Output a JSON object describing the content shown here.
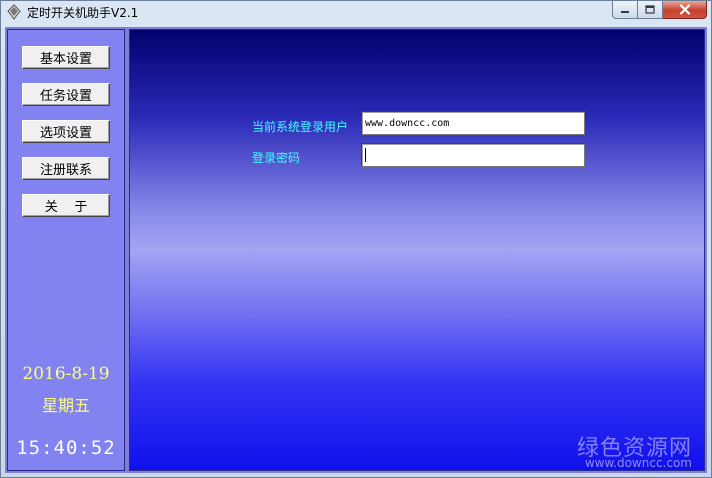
{
  "window": {
    "title": "定时开关机助手V2.1"
  },
  "sidebar": {
    "buttons": [
      {
        "label": "基本设置"
      },
      {
        "label": "任务设置"
      },
      {
        "label": "选项设置"
      },
      {
        "label": "注册联系"
      },
      {
        "label": "关    于"
      }
    ],
    "date": "2016-8-19",
    "weekday": "星期五",
    "time": "15:40:52"
  },
  "login": {
    "user_label": "当前系统登录用户",
    "user_value": "www.downcc.com",
    "password_label": "登录密码",
    "password_value": ""
  },
  "watermark": {
    "site_name": "绿色资源网",
    "url": "www.downcc.com"
  },
  "colors": {
    "sidebar_bg": "#8282f0",
    "label_color": "#40ffff",
    "date_color": "#ffff80"
  }
}
